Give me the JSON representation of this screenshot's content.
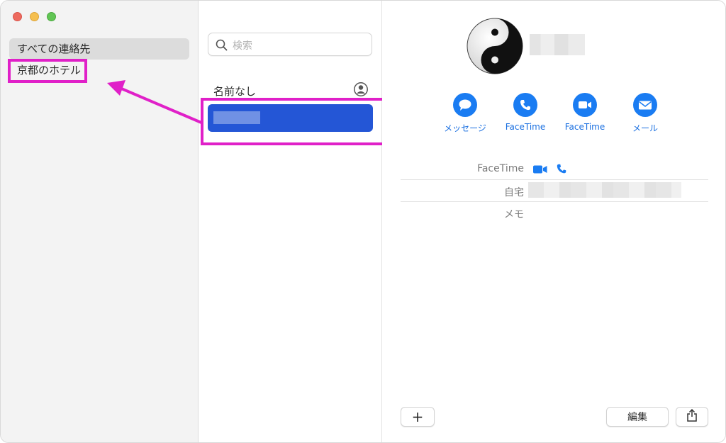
{
  "sidebar": {
    "groups": [
      {
        "label": "すべての連絡先",
        "selected": true
      },
      {
        "label": "京都のホテル",
        "selected": false
      }
    ]
  },
  "list": {
    "search_placeholder": "検索",
    "header": "名前なし"
  },
  "detail": {
    "actions": [
      {
        "label": "メッセージ",
        "icon": "message-bubble-icon"
      },
      {
        "label": "FaceTime",
        "icon": "phone-icon"
      },
      {
        "label": "FaceTime",
        "icon": "video-camera-icon"
      },
      {
        "label": "メール",
        "icon": "envelope-icon"
      }
    ],
    "fields": {
      "facetime_label": "FaceTime",
      "home_label": "自宅",
      "memo_label": "メモ"
    },
    "buttons": {
      "add": "+",
      "edit": "編集"
    }
  },
  "colors": {
    "accent": "#1a7cf2",
    "selection": "#2456d6",
    "annotation": "#e020c8"
  }
}
